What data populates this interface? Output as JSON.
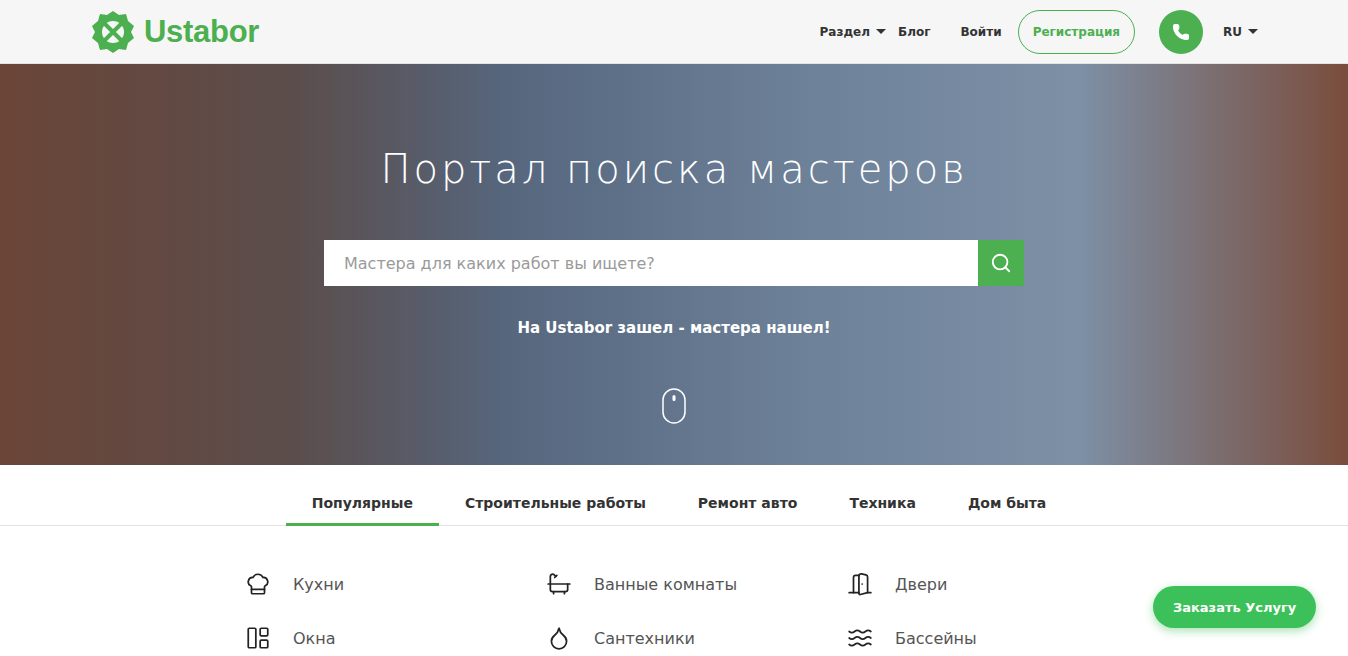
{
  "header": {
    "logo": "Ustabor",
    "nav": [
      {
        "label": "Раздел",
        "kind": "dropdown"
      },
      {
        "label": "Блог",
        "kind": "link"
      },
      {
        "label": "Войти",
        "kind": "link"
      }
    ],
    "register": "Регистрация",
    "language": "RU"
  },
  "hero": {
    "title": "Портал поиска мастеров",
    "search": {
      "placeholder": "Мастера для каких работ вы ищете?"
    },
    "slogan": "На Ustabor зашел - мастера нашел!"
  },
  "tabs": [
    {
      "label": "Популярные",
      "selected": true
    },
    {
      "label": "Строительные работы",
      "selected": false
    },
    {
      "label": "Ремонт авто",
      "selected": false
    },
    {
      "label": "Техника",
      "selected": false
    },
    {
      "label": "Дом быта",
      "selected": false
    }
  ],
  "categories": [
    {
      "name": "Кухни"
    },
    {
      "name": "Ванные комнаты"
    },
    {
      "name": "Двери"
    },
    {
      "name": "Окна"
    },
    {
      "name": "Сантехники"
    },
    {
      "name": "Бассейны"
    }
  ],
  "floating_button": "Заказать Услугу"
}
